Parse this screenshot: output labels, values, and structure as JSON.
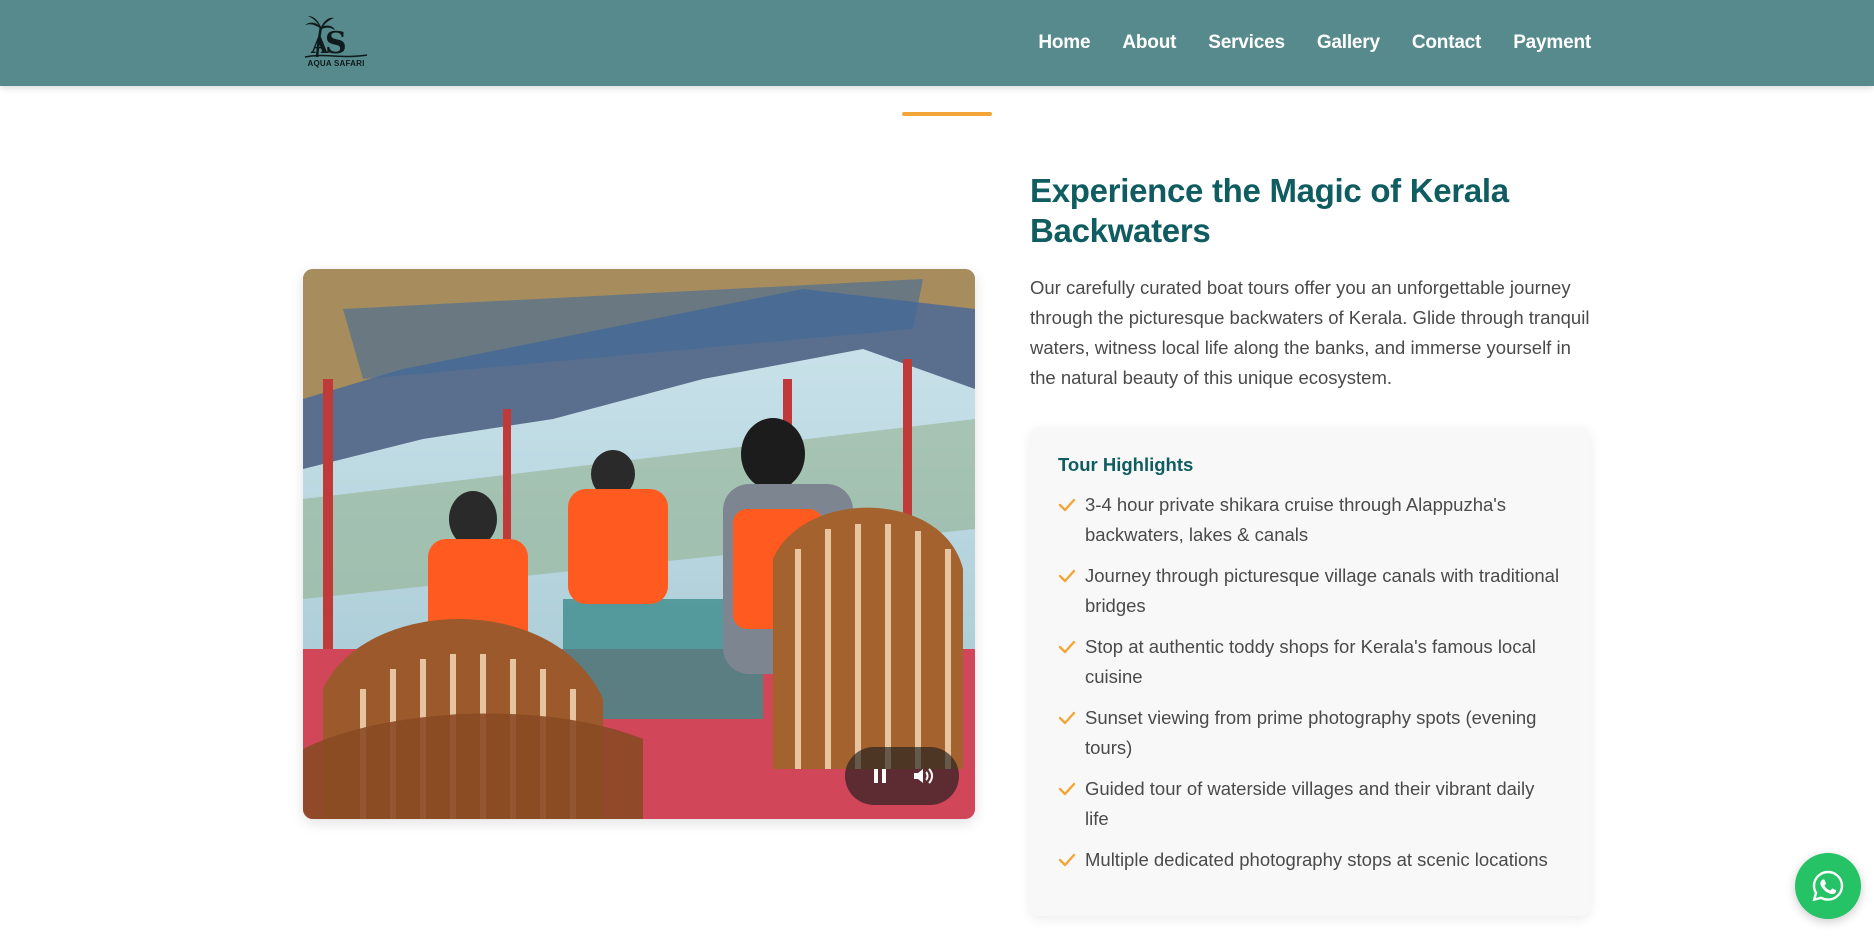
{
  "brand": {
    "logo_text": "AQUA SAFARI",
    "logo_initials": "AS"
  },
  "nav": {
    "items": [
      {
        "label": "Home"
      },
      {
        "label": "About"
      },
      {
        "label": "Services"
      },
      {
        "label": "Gallery"
      },
      {
        "label": "Contact"
      },
      {
        "label": "Payment"
      }
    ]
  },
  "section": {
    "title": "Experience the Magic of Kerala Backwaters",
    "description": "Our carefully curated boat tours offer you an unforgettable journey through the picturesque backwaters of Kerala. Glide through tranquil waters, witness local life along the banks, and immerse yourself in the natural beauty of this unique ecosystem."
  },
  "video": {
    "controls": [
      "pause-icon",
      "volume-icon"
    ],
    "state": "playing"
  },
  "highlights": {
    "title": "Tour Highlights",
    "items": [
      "3-4 hour private shikara cruise through Alappuzha's backwaters, lakes & canals",
      "Journey through picturesque village canals with traditional bridges",
      "Stop at authentic toddy shops for Kerala's famous local cuisine",
      "Sunset viewing from prime photography spots (evening tours)",
      "Guided tour of waterside villages and their vibrant daily life",
      "Multiple dedicated photography stops at scenic locations"
    ]
  },
  "colors": {
    "navbar": "#578a8d",
    "accent": "#f3a637",
    "heading": "#0f5c61",
    "whatsapp": "#25c266"
  },
  "floating": {
    "icon": "whatsapp-icon"
  }
}
